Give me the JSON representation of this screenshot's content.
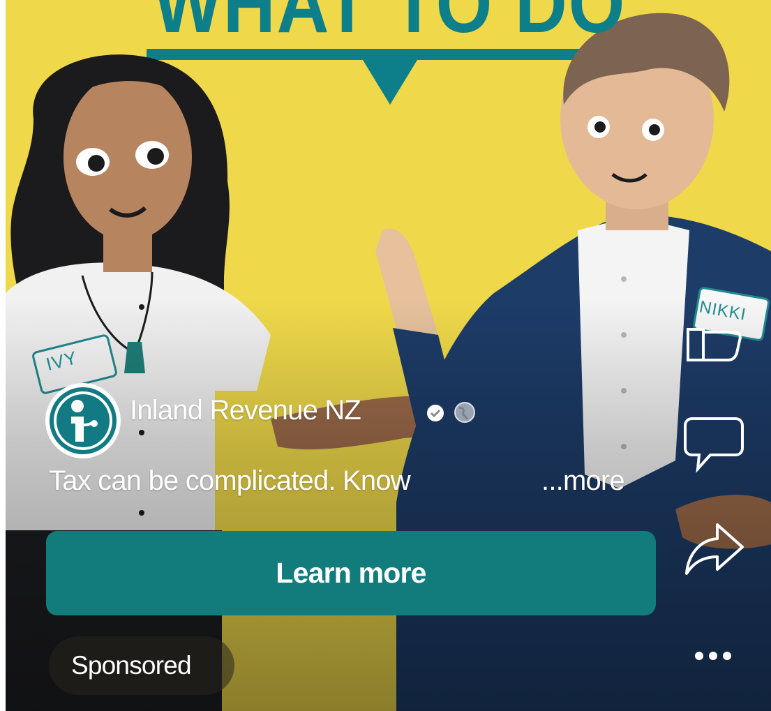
{
  "poster": {
    "headline": "WHAT TO DO",
    "tag_left": "IVY",
    "tag_right": "NIKKI"
  },
  "post": {
    "page_name": "Inland Revenue NZ",
    "caption": "Tax can be complicated. Know",
    "more_label": "...more",
    "cta_label": "Learn more",
    "sponsored_label": "Sponsored"
  },
  "icons": {
    "avatar": "inland-revenue-logo-icon",
    "verified": "verified-badge-icon",
    "audience": "globe-icon",
    "like": "thumbs-up-icon",
    "comment": "comment-icon",
    "share": "share-icon",
    "more": "more-options-icon"
  },
  "colors": {
    "background": "#efd94a",
    "brand_teal": "#127c7d",
    "headline_teal": "#0d7f8a",
    "jacket_navy": "#1d3c68"
  }
}
